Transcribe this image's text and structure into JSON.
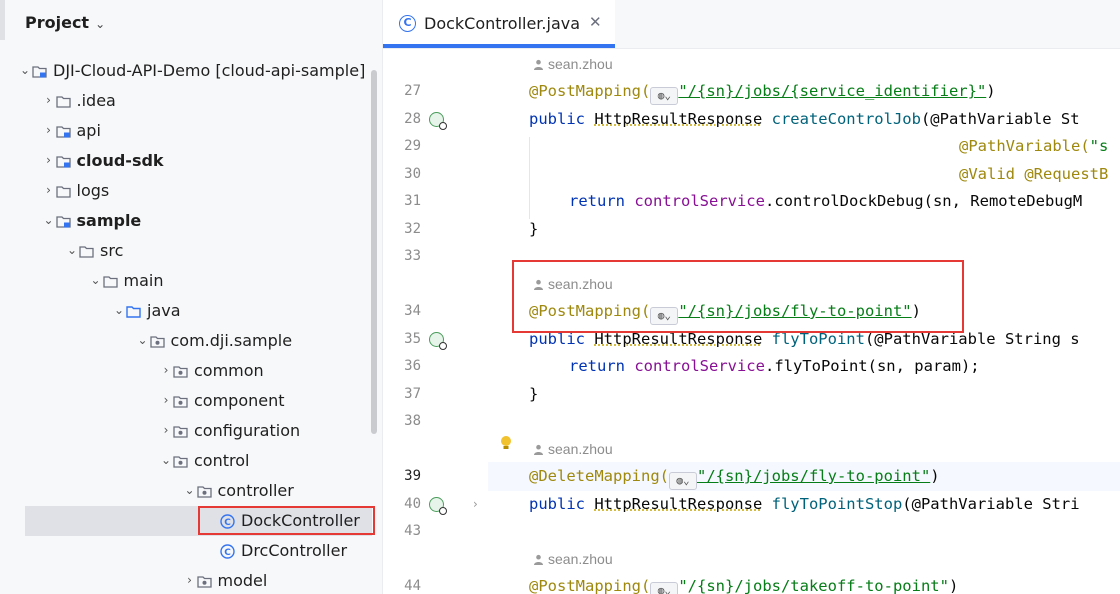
{
  "sidebar": {
    "title": "Project",
    "tree": [
      {
        "label": "DJI-Cloud-API-Demo [cloud-api-sample]",
        "arrow": "⌄",
        "icon": "module-folder-icon",
        "indent": 0,
        "bold": false
      },
      {
        "label": ".idea",
        "arrow": "›",
        "icon": "folder-icon",
        "indent": 1,
        "bold": false
      },
      {
        "label": "api",
        "arrow": "›",
        "icon": "module-folder-icon",
        "indent": 1,
        "bold": false
      },
      {
        "label": "cloud-sdk",
        "arrow": "›",
        "icon": "module-folder-icon",
        "indent": 1,
        "bold": true
      },
      {
        "label": "logs",
        "arrow": "›",
        "icon": "folder-icon",
        "indent": 1,
        "bold": false
      },
      {
        "label": "sample",
        "arrow": "⌄",
        "icon": "module-folder-icon",
        "indent": 1,
        "bold": true
      },
      {
        "label": "src",
        "arrow": "⌄",
        "icon": "folder-icon",
        "indent": 2,
        "bold": false
      },
      {
        "label": "main",
        "arrow": "⌄",
        "icon": "folder-icon",
        "indent": 3,
        "bold": false
      },
      {
        "label": "java",
        "arrow": "⌄",
        "icon": "source-folder-icon",
        "indent": 4,
        "bold": false
      },
      {
        "label": "com.dji.sample",
        "arrow": "⌄",
        "icon": "package-icon",
        "indent": 5,
        "bold": false
      },
      {
        "label": "common",
        "arrow": "›",
        "icon": "package-icon",
        "indent": 6,
        "bold": false
      },
      {
        "label": "component",
        "arrow": "›",
        "icon": "package-icon",
        "indent": 6,
        "bold": false
      },
      {
        "label": "configuration",
        "arrow": "›",
        "icon": "package-icon",
        "indent": 6,
        "bold": false
      },
      {
        "label": "control",
        "arrow": "⌄",
        "icon": "package-icon",
        "indent": 6,
        "bold": false
      },
      {
        "label": "controller",
        "arrow": "⌄",
        "icon": "package-icon",
        "indent": 7,
        "bold": false
      },
      {
        "label": "DockController",
        "arrow": "",
        "icon": "class-icon",
        "indent": 8,
        "bold": false,
        "selected": true
      },
      {
        "label": "DrcController",
        "arrow": "",
        "icon": "class-icon",
        "indent": 8,
        "bold": false
      },
      {
        "label": "model",
        "arrow": "›",
        "icon": "package-icon",
        "indent": 7,
        "bold": false
      }
    ]
  },
  "editor": {
    "tab": {
      "label": "DockController.java",
      "close": "✕"
    },
    "author": "sean.zhou",
    "line_numbers": [
      "27",
      "28",
      "29",
      "30",
      "31",
      "32",
      "33",
      "34",
      "35",
      "36",
      "37",
      "38",
      "39",
      "40",
      "43",
      "44"
    ],
    "lines": {
      "l27": {
        "ann": "@PostMapping(",
        "path": "\"/{sn}/jobs/{service_identifier}\"",
        "end": ")"
      },
      "l28": {
        "kw": "public ",
        "typ": "HttpResultResponse",
        "fn": " createControlJob",
        "rest": "(@PathVariable St"
      },
      "l29": {
        "ann": "@PathVariable(",
        "str": "\"s"
      },
      "l30": {
        "ann": "@Valid @RequestB"
      },
      "l31": {
        "kw": "return ",
        "field": "controlService",
        "rest": ".controlDockDebug(sn, RemoteDebugM"
      },
      "l32": {
        "rest": "}"
      },
      "l34": {
        "ann": "@PostMapping(",
        "path": "\"/{sn}/jobs/fly-to-point\"",
        "end": ")"
      },
      "l35": {
        "kw": "public ",
        "typ": "HttpResultResponse",
        "fn": " flyToPoint",
        "rest": "(@PathVariable String s"
      },
      "l36": {
        "kw": "return ",
        "field": "controlService",
        "rest": ".flyToPoint(sn, param);"
      },
      "l37": {
        "rest": "}"
      },
      "l39": {
        "ann": "@DeleteMapping(",
        "path": "\"/{sn}/jobs/fly-to-point\"",
        "end": ")"
      },
      "l40": {
        "kw": "public ",
        "typ": "HttpResultResponse",
        "fn": " flyToPointStop",
        "rest": "(@PathVariable Stri"
      },
      "l44": {
        "ann": "@PostMapping(",
        "path": "\"/{sn}/jobs/takeoff-to-point\"",
        "end": ")"
      }
    }
  },
  "colors": {
    "accent": "#3574f0",
    "highlight": "#e53935",
    "annotation": "#9e880d",
    "keyword": "#0033b3",
    "string": "#067d17"
  }
}
